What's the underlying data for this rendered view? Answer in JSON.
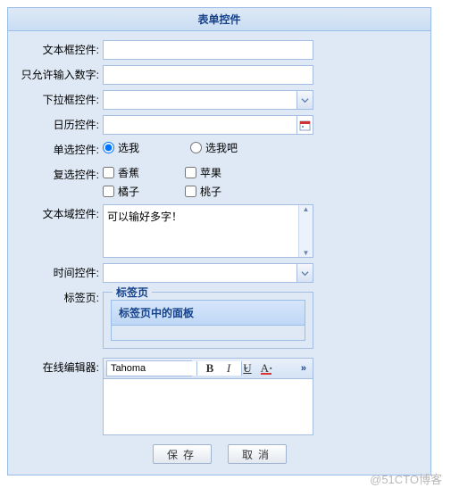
{
  "panel": {
    "title": "表单控件"
  },
  "labels": {
    "text": "文本框控件:",
    "number": "只允许输入数字:",
    "combo": "下拉框控件:",
    "date": "日历控件:",
    "radio": "单选控件:",
    "check": "复选控件:",
    "textarea": "文本域控件:",
    "time": "时间控件:",
    "tab": "标签页:",
    "editor": "在线编辑器:"
  },
  "radio": {
    "opt1": "选我",
    "opt2": "选我吧"
  },
  "check": {
    "banana": "香蕉",
    "apple": "苹果",
    "orange": "橘子",
    "peach": "桃子"
  },
  "textarea": {
    "value": "可以输好多字！"
  },
  "fieldset": {
    "legend": "标签页",
    "panel_title": "标签页中的面板"
  },
  "editor": {
    "font": "Tahoma",
    "bold": "B",
    "italic": "I",
    "underline": "U",
    "fontcolor": "A",
    "expand": "»"
  },
  "buttons": {
    "save": "保存",
    "cancel": "取消"
  },
  "watermark": "@51CTO博客"
}
